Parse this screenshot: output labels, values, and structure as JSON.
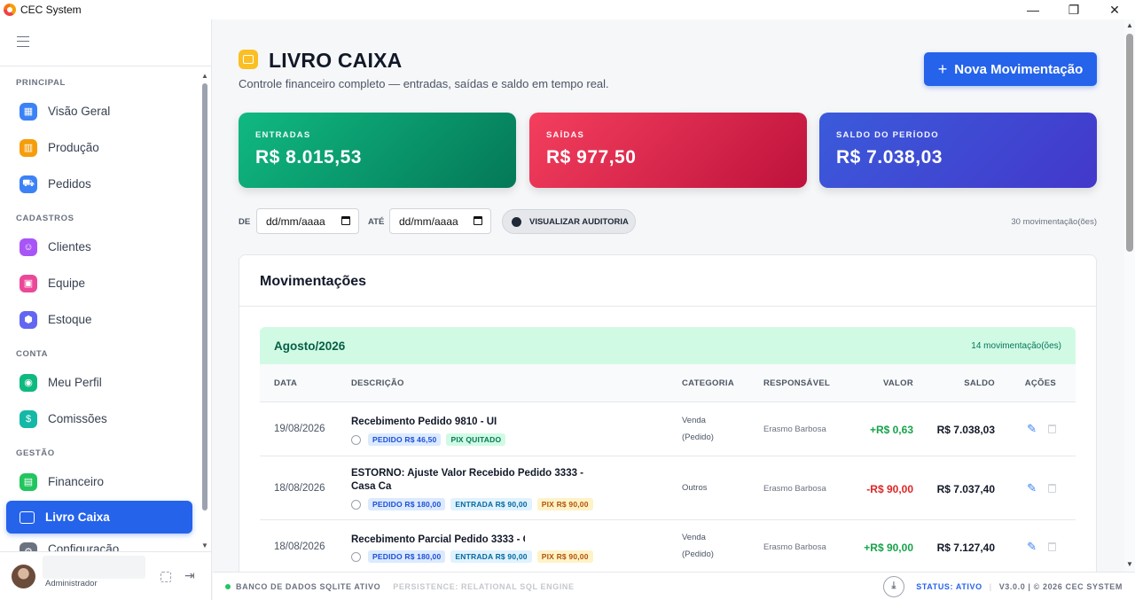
{
  "window": {
    "title": "CEC System",
    "controls": {
      "minimize": "—",
      "maximize": "❐",
      "close": "✕"
    }
  },
  "sidebar": {
    "sections": [
      {
        "label": "PRINCIPAL",
        "items": [
          {
            "label": "Visão Geral",
            "icon": "grid-icon",
            "color": "#3b82f6"
          },
          {
            "label": "Produção",
            "icon": "factory-icon",
            "color": "#f59e0b"
          },
          {
            "label": "Pedidos",
            "icon": "cart-icon",
            "color": "#3b82f6"
          }
        ]
      },
      {
        "label": "CADASTROS",
        "items": [
          {
            "label": "Clientes",
            "icon": "users-icon",
            "color": "#a855f7"
          },
          {
            "label": "Equipe",
            "icon": "briefcase-icon",
            "color": "#ec4899"
          },
          {
            "label": "Estoque",
            "icon": "box-icon",
            "color": "#6366f1"
          }
        ]
      },
      {
        "label": "CONTA",
        "items": [
          {
            "label": "Meu Perfil",
            "icon": "user-circle-icon",
            "color": "#10b981"
          },
          {
            "label": "Comissões",
            "icon": "dollar-icon",
            "color": "#14b8a6"
          }
        ]
      },
      {
        "label": "GESTÃO",
        "items": [
          {
            "label": "Financeiro",
            "icon": "document-icon",
            "color": "#22c55e"
          },
          {
            "label": "Livro Caixa",
            "icon": "wallet-icon",
            "color": "#2563eb",
            "active": true
          }
        ]
      }
    ],
    "partial_item": "Configuração",
    "user": {
      "role": "Administrador"
    }
  },
  "page": {
    "title": "LIVRO CAIXA",
    "subtitle": "Controle financeiro completo — entradas, saídas e saldo em tempo real.",
    "new_button": "Nova Movimentação"
  },
  "cards": {
    "entradas": {
      "label": "ENTRADAS",
      "value": "R$ 8.015,53"
    },
    "saidas": {
      "label": "SAÍDAS",
      "value": "R$ 977,50"
    },
    "saldo": {
      "label": "SALDO DO PERÍODO",
      "value": "R$ 7.038,03"
    }
  },
  "filters": {
    "from_label": "DE",
    "from_placeholder": "dd/mm/aaaa",
    "to_label": "ATÉ",
    "to_placeholder": "dd/mm/aaaa",
    "audit_button": "VISUALIZAR AUDITORIA",
    "count": "30 movimentação(ões)"
  },
  "panel": {
    "title": "Movimentações",
    "month": "Agosto/2026",
    "month_count": "14 movimentação(ões)",
    "columns": [
      "DATA",
      "DESCRIÇÃO",
      "CATEGORIA",
      "RESPONSÁVEL",
      "VALOR",
      "SALDO",
      "AÇÕES"
    ],
    "rows": [
      {
        "date": "19/08/2026",
        "description": "Recebimento Pedido 9810 - UI",
        "tags": [
          {
            "text": "PEDIDO R$ 46,50",
            "kind": "blue"
          },
          {
            "text": "PIX QUITADO",
            "kind": "green"
          }
        ],
        "category": "Venda",
        "category2": "(Pedido)",
        "responsible": "Erasmo Barbosa",
        "value": "+R$ 0,63",
        "balance": "R$ 7.038,03"
      },
      {
        "date": "18/08/2026",
        "description": "ESTORNO: Ajuste Valor Recebido Pedido 3333 - Casa Ca",
        "tags": [
          {
            "text": "PEDIDO R$ 180,00",
            "kind": "blue"
          },
          {
            "text": "ENTRADA R$ 90,00",
            "kind": "blue"
          },
          {
            "text": "PIX R$ 90,00",
            "kind": "yellow"
          }
        ],
        "category": "Outros",
        "category2": "",
        "responsible": "Erasmo Barbosa",
        "value": "-R$ 90,00",
        "balance": "R$ 7.037,40"
      },
      {
        "date": "18/08/2026",
        "description": "Recebimento Parcial Pedido 3333 - Ca",
        "tags": [
          {
            "text": "PEDIDO R$ 180,00",
            "kind": "blue"
          },
          {
            "text": "ENTRADA R$ 90,00",
            "kind": "blue"
          },
          {
            "text": "PIX R$ 90,00",
            "kind": "yellow"
          }
        ],
        "category": "Venda",
        "category2": "(Pedido)",
        "responsible": "Erasmo Barbosa",
        "value": "+R$ 90,00",
        "balance": "R$ 7.127,40"
      }
    ]
  },
  "statusbar": {
    "db": "BANCO DE DADOS SQLITE ATIVO",
    "persistence": "PERSISTENCE: RELATIONAL SQL ENGINE",
    "status": "STATUS: ATIVO",
    "separator": "|",
    "version": "V3.0.0 | © 2026 CEC SYSTEM"
  }
}
